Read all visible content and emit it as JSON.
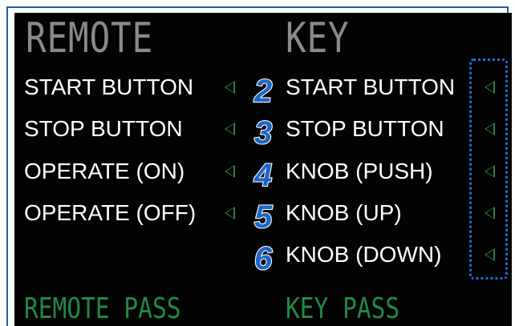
{
  "titles": {
    "remote": "REMOTE",
    "key": "KEY"
  },
  "remote_rows": [
    {
      "label": "START BUTTON"
    },
    {
      "label": "STOP BUTTON"
    },
    {
      "label": "OPERATE (ON)"
    },
    {
      "label": "OPERATE (OFF)"
    }
  ],
  "key_rows": [
    {
      "number": "2",
      "label": "START BUTTON"
    },
    {
      "number": "3",
      "label": "STOP BUTTON"
    },
    {
      "number": "4",
      "label": "KNOB (PUSH)"
    },
    {
      "number": "5",
      "label": "KNOB (UP)"
    },
    {
      "number": "6",
      "label": "KNOB (DOWN)"
    }
  ],
  "footer": {
    "remote_pass": "REMOTE PASS",
    "key_pass": "KEY PASS"
  },
  "icons": {
    "indicator": "triangle-left-outline-icon"
  },
  "colors": {
    "screen_bg": "#030303",
    "title_gray": "#8a8a8a",
    "indicator_green": "#2f7f3f",
    "pass_green": "#1f8a44",
    "callout_blue": "#1e66c8",
    "frame_blue": "#1f5fa6"
  }
}
